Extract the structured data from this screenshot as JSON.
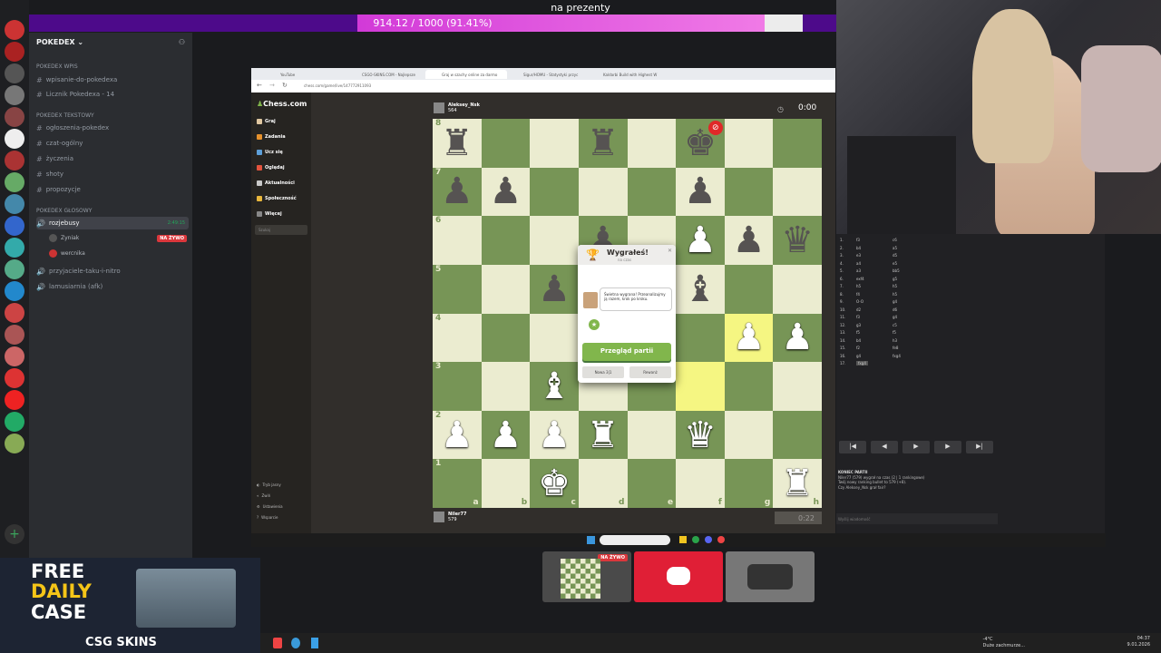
{
  "stream": {
    "goal_title": "na prezenty",
    "goal_progress_text": "914.12 / 1000 (91.41%)",
    "goal_fraction": 0.9141
  },
  "discord": {
    "server_name": "POKEDEX",
    "categories": [
      {
        "name": "POKEDEX Wpis",
        "channels": [
          "wpisanie-do-pokedexa",
          "Licznik Pokedexa - 14"
        ]
      },
      {
        "name": "POKEDEX Tekstowy",
        "channels": [
          "ogłoszenia-pokedex",
          "czat-ogólny",
          "życzenia",
          "shoty",
          "propozycje"
        ]
      },
      {
        "name": "POKEDEX GŁOSOWY",
        "channels": [
          "rozjebusy"
        ]
      }
    ],
    "voice_time": "2:49:15",
    "voice_users": [
      "Zyniak",
      "wercnika"
    ],
    "live_badge": "NA ŻYWO",
    "other_channels": [
      "przyjaciele-taku-i-nitro",
      "lamusiarnia (afk)"
    ]
  },
  "browser": {
    "tabs": [
      "YouTube",
      "CSGO-SKINS.COM - Najlepsze",
      "Graj w szachy online za darmo",
      "Sigur/HOMU - Statystyki przyc",
      "Kaldarbi Build with Highest W"
    ],
    "url": "chess.com/game/live/147772911093"
  },
  "chesscom": {
    "logo": "Chess.com",
    "nav": [
      "Graj",
      "Zadania",
      "Ucz się",
      "Oglądaj",
      "Aktualności",
      "Społeczność",
      "Więcej"
    ],
    "search_placeholder": "Szukaj",
    "bottom_nav": [
      "Tryb jasny",
      "Zwiń",
      "Ustawienia",
      "Wsparcie"
    ],
    "top_player": "Aleksey_Nsk",
    "top_rating": "564",
    "top_clock": "0:00",
    "bottom_player": "Niler77",
    "bottom_rating": "579",
    "bottom_clock": "0:22",
    "files": [
      "a",
      "b",
      "c",
      "d",
      "e",
      "f",
      "g",
      "h"
    ],
    "ranks": [
      "8",
      "7",
      "6",
      "5",
      "4",
      "3",
      "2",
      "1"
    ],
    "board": [
      [
        "bR",
        "",
        "",
        "bR",
        "",
        "bK",
        "",
        ""
      ],
      [
        "bP",
        "bP",
        "",
        "",
        "",
        "bP",
        "",
        ""
      ],
      [
        "",
        "",
        "",
        "bP",
        "",
        "wP",
        "bP",
        "bQ"
      ],
      [
        "",
        "",
        "bP",
        "",
        "",
        "bB",
        "",
        ""
      ],
      [
        "",
        "",
        "",
        "",
        "",
        "",
        "wP",
        "wP"
      ],
      [
        "",
        "",
        "wB",
        "",
        "",
        "",
        "",
        ""
      ],
      [
        "wP",
        "wP",
        "wP",
        "wR",
        "",
        "wQ",
        "",
        ""
      ],
      [
        "",
        "",
        "wK",
        "",
        "",
        "",
        "",
        "wR"
      ]
    ],
    "highlights": [
      "f3",
      "g4"
    ],
    "modal": {
      "title": "Wygrałeś!",
      "subtitle": "na czas",
      "bubble": "Świetna wygrana! Przeanalizujmy ją razem, krok po kroku.",
      "review_button": "Przegląd partii",
      "new_game_button": "Nowa 3|1",
      "rematch_button": "Rewanż"
    }
  },
  "move_list": [
    [
      "1.",
      "f3",
      "c6"
    ],
    [
      "2.",
      "b4",
      "a5"
    ],
    [
      "3.",
      "e3",
      "d5"
    ],
    [
      "4.",
      "a4",
      "e5"
    ],
    [
      "5.",
      "a3",
      "bb5"
    ],
    [
      "6.",
      "exf4",
      "g5"
    ],
    [
      "7.",
      "h5",
      "h5"
    ],
    [
      "8.",
      "f4",
      "h5"
    ],
    [
      "9.",
      "O-O",
      "g4"
    ],
    [
      "10.",
      "d2",
      "d6"
    ],
    [
      "11.",
      "f3",
      "g4"
    ],
    [
      "12.",
      "g3",
      "c5"
    ],
    [
      "13.",
      "f5",
      "f5"
    ],
    [
      "14.",
      "b4",
      "h3"
    ],
    [
      "15.",
      "f2",
      "fe8"
    ],
    [
      "16.",
      "g4",
      "fxg4"
    ],
    [
      "17.",
      "fxg4",
      ""
    ]
  ],
  "move_controls": [
    "|◀",
    "◀",
    "▶",
    "▶",
    "▶|"
  ],
  "chat_log": [
    "KONIEC PARTII",
    "Niler77 (579) wygrał na czas (2 | 1 rankingowe)",
    "Twój nowy ranking bullet to 579 (+8).",
    "Czy Aleksey_Nsk grał fair?"
  ],
  "chat_placeholder": "Wyślij wiadomość",
  "preview": {
    "live_badge": "NA ŻYWO"
  },
  "ad": {
    "line1": "FREE",
    "line2": "DAILY",
    "line3": "CASE",
    "brand": "CSG SKINS"
  },
  "host_taskbar": {
    "weather_temp": "-4°C",
    "weather_text": "Duże zachmurze...",
    "time": "04:37",
    "date": "9.01.2026"
  }
}
